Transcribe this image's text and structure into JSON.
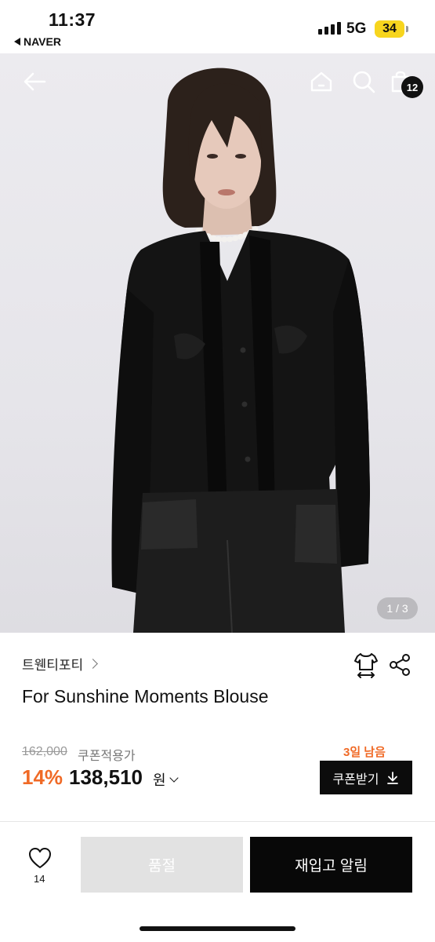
{
  "status_bar": {
    "time": "11:37",
    "back_app": "NAVER",
    "network": "5G",
    "battery": "34",
    "battery_color": "#f7d51e"
  },
  "header": {
    "icons": [
      "back-arrow-icon",
      "home-icon",
      "search-icon",
      "shopping-bag-icon"
    ],
    "cart_count": "12"
  },
  "gallery": {
    "pager": "1 / 3",
    "image_description_icon": "model-photo"
  },
  "product": {
    "brand": "트웬티포티",
    "title": "For Sunshine Moments Blouse",
    "original_price": "162,000",
    "coupon_price_label": "쿠폰적용가",
    "discount": "14%",
    "price": "138,510",
    "currency": "원",
    "days_left": "3일 남음",
    "coupon_button": "쿠폰받기",
    "accent_color": "#f06a26"
  },
  "bottom_bar": {
    "like_count": "14",
    "soldout_label": "품절",
    "restock_label": "재입고 알림"
  }
}
